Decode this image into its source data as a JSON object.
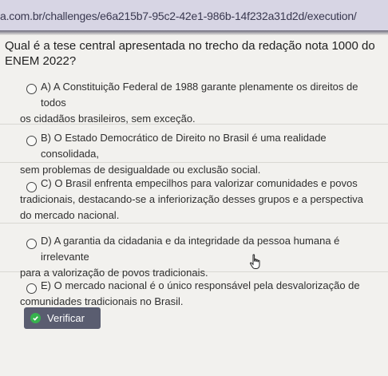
{
  "browser": {
    "url": "a.com.br/challenges/e6a215b7-95c2-42e1-986b-14f232a31d2d/execution/"
  },
  "question": {
    "text": "Qual é a tese central apresentada no trecho da redação nota 1000 do ENEM 2022?"
  },
  "options": [
    {
      "line1": "A) A Constituição Federal de 1988 garante plenamente os direitos de todos",
      "line2": "os cidadãos brasileiros, sem exceção.",
      "line3": ""
    },
    {
      "line1": "B) O Estado Democrático de Direito no Brasil é uma realidade consolidada,",
      "line2": "sem problemas de desigualdade ou exclusão social.",
      "line3": ""
    },
    {
      "line1": "C) O Brasil enfrenta empecilhos para valorizar comunidades e povos",
      "line2": "tradicionais, destacando-se a inferiorização desses grupos e a perspectiva",
      "line3": "do mercado nacional."
    },
    {
      "line1": "D) A garantia da cidadania e da integridade da pessoa humana é irrelevante",
      "line2": "para a valorização de povos tradicionais.",
      "line3": ""
    },
    {
      "line1": "E) O mercado nacional é o único responsável pela desvalorização de",
      "line2": "comunidades tradicionais no Brasil.",
      "line3": ""
    }
  ],
  "actions": {
    "verify_label": "Verificar"
  },
  "colors": {
    "url_bar_bg": "#d7d5e4",
    "button_bg": "#5a5d70",
    "check_green": "#37b24d"
  },
  "icons": [
    "check-circle-icon",
    "hand-cursor-icon",
    "radio-icon"
  ]
}
